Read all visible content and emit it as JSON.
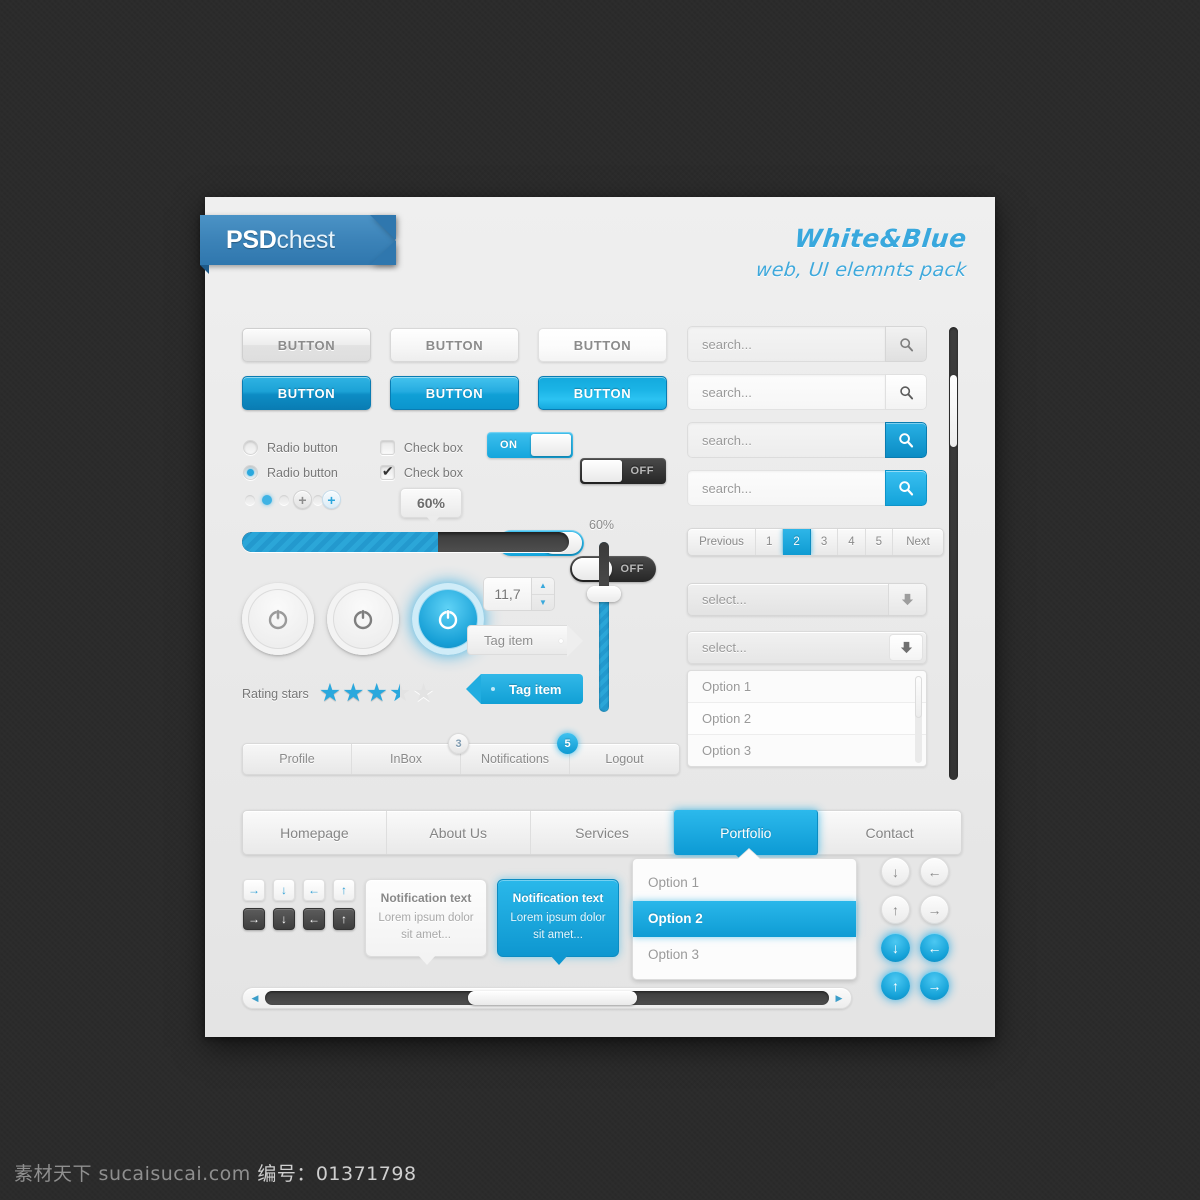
{
  "brand": {
    "bold": "PSD",
    "light": "chest"
  },
  "kit": {
    "title": "White&Blue",
    "subtitle": "web, UI elemnts pack"
  },
  "buttons": {
    "gray": [
      "BUTTON",
      "BUTTON",
      "BUTTON"
    ],
    "blue": [
      "BUTTON",
      "BUTTON",
      "BUTTON"
    ]
  },
  "controls": {
    "radio_1": "Radio button",
    "radio_2": "Radio button",
    "check_1": "Check box",
    "check_2": "Check box"
  },
  "toggles": {
    "square_on": "ON",
    "square_off": "OFF",
    "round_on": "ON",
    "round_off": "OFF"
  },
  "progress": {
    "tooltip": "60%",
    "percent": 60
  },
  "vslider": {
    "label": "60%",
    "percent": 60
  },
  "rating": {
    "label": "Rating stars",
    "value": 3.5,
    "max": 5
  },
  "spinner": {
    "value": "11,7",
    "up": "▲",
    "down": "▼"
  },
  "tags": {
    "gray": "Tag item",
    "blue": "Tag item"
  },
  "search": {
    "placeholder": "search...",
    "fields": [
      "search...",
      "search...",
      "search...",
      "search..."
    ]
  },
  "pagination": {
    "previous": "Previous",
    "pages": [
      "1",
      "2",
      "3",
      "4",
      "5"
    ],
    "active": "2",
    "next": "Next"
  },
  "selects": {
    "placeholder": "select...",
    "first": "select...",
    "second": "select..."
  },
  "listbox": {
    "options": [
      "Option 1",
      "Option 2",
      "Option 3"
    ]
  },
  "account_tabs": [
    {
      "label": "Profile",
      "badge": null,
      "badge_style": null
    },
    {
      "label": "InBox",
      "badge": "3",
      "badge_style": "gray"
    },
    {
      "label": "Notifications",
      "badge": "5",
      "badge_style": "blue"
    },
    {
      "label": "Logout",
      "badge": null,
      "badge_style": null
    }
  ],
  "main_nav": {
    "items": [
      "Homepage",
      "About Us",
      "Services",
      "Portfolio",
      "Contact"
    ],
    "active": "Portfolio"
  },
  "nav_dropdown": {
    "options": [
      "Option 1",
      "Option 2",
      "Option 3"
    ],
    "active": "Option 2"
  },
  "arrow_icons": {
    "right": "→",
    "down": "↓",
    "left": "←",
    "up": "↑",
    "scroll_left": "◀",
    "scroll_right": "▶"
  },
  "notifications": {
    "gray": {
      "title": "Notification text",
      "body": "Lorem ipsum dolor sit amet..."
    },
    "blue": {
      "title": "Notification text",
      "body": "Lorem ipsum dolor sit amet..."
    }
  },
  "icons": {
    "search": "⚲",
    "power": "power-icon",
    "select_arrow": "⬇"
  },
  "colors": {
    "accent": "#1ca2d6",
    "accent_light": "#3fc2f0",
    "dark": "#3c3c3c",
    "page_bg": "#2b2b2b",
    "card_bg": "#ececec"
  },
  "watermark": {
    "site": "素材天下 sucaisucai.com",
    "id": "编号：01371798"
  }
}
